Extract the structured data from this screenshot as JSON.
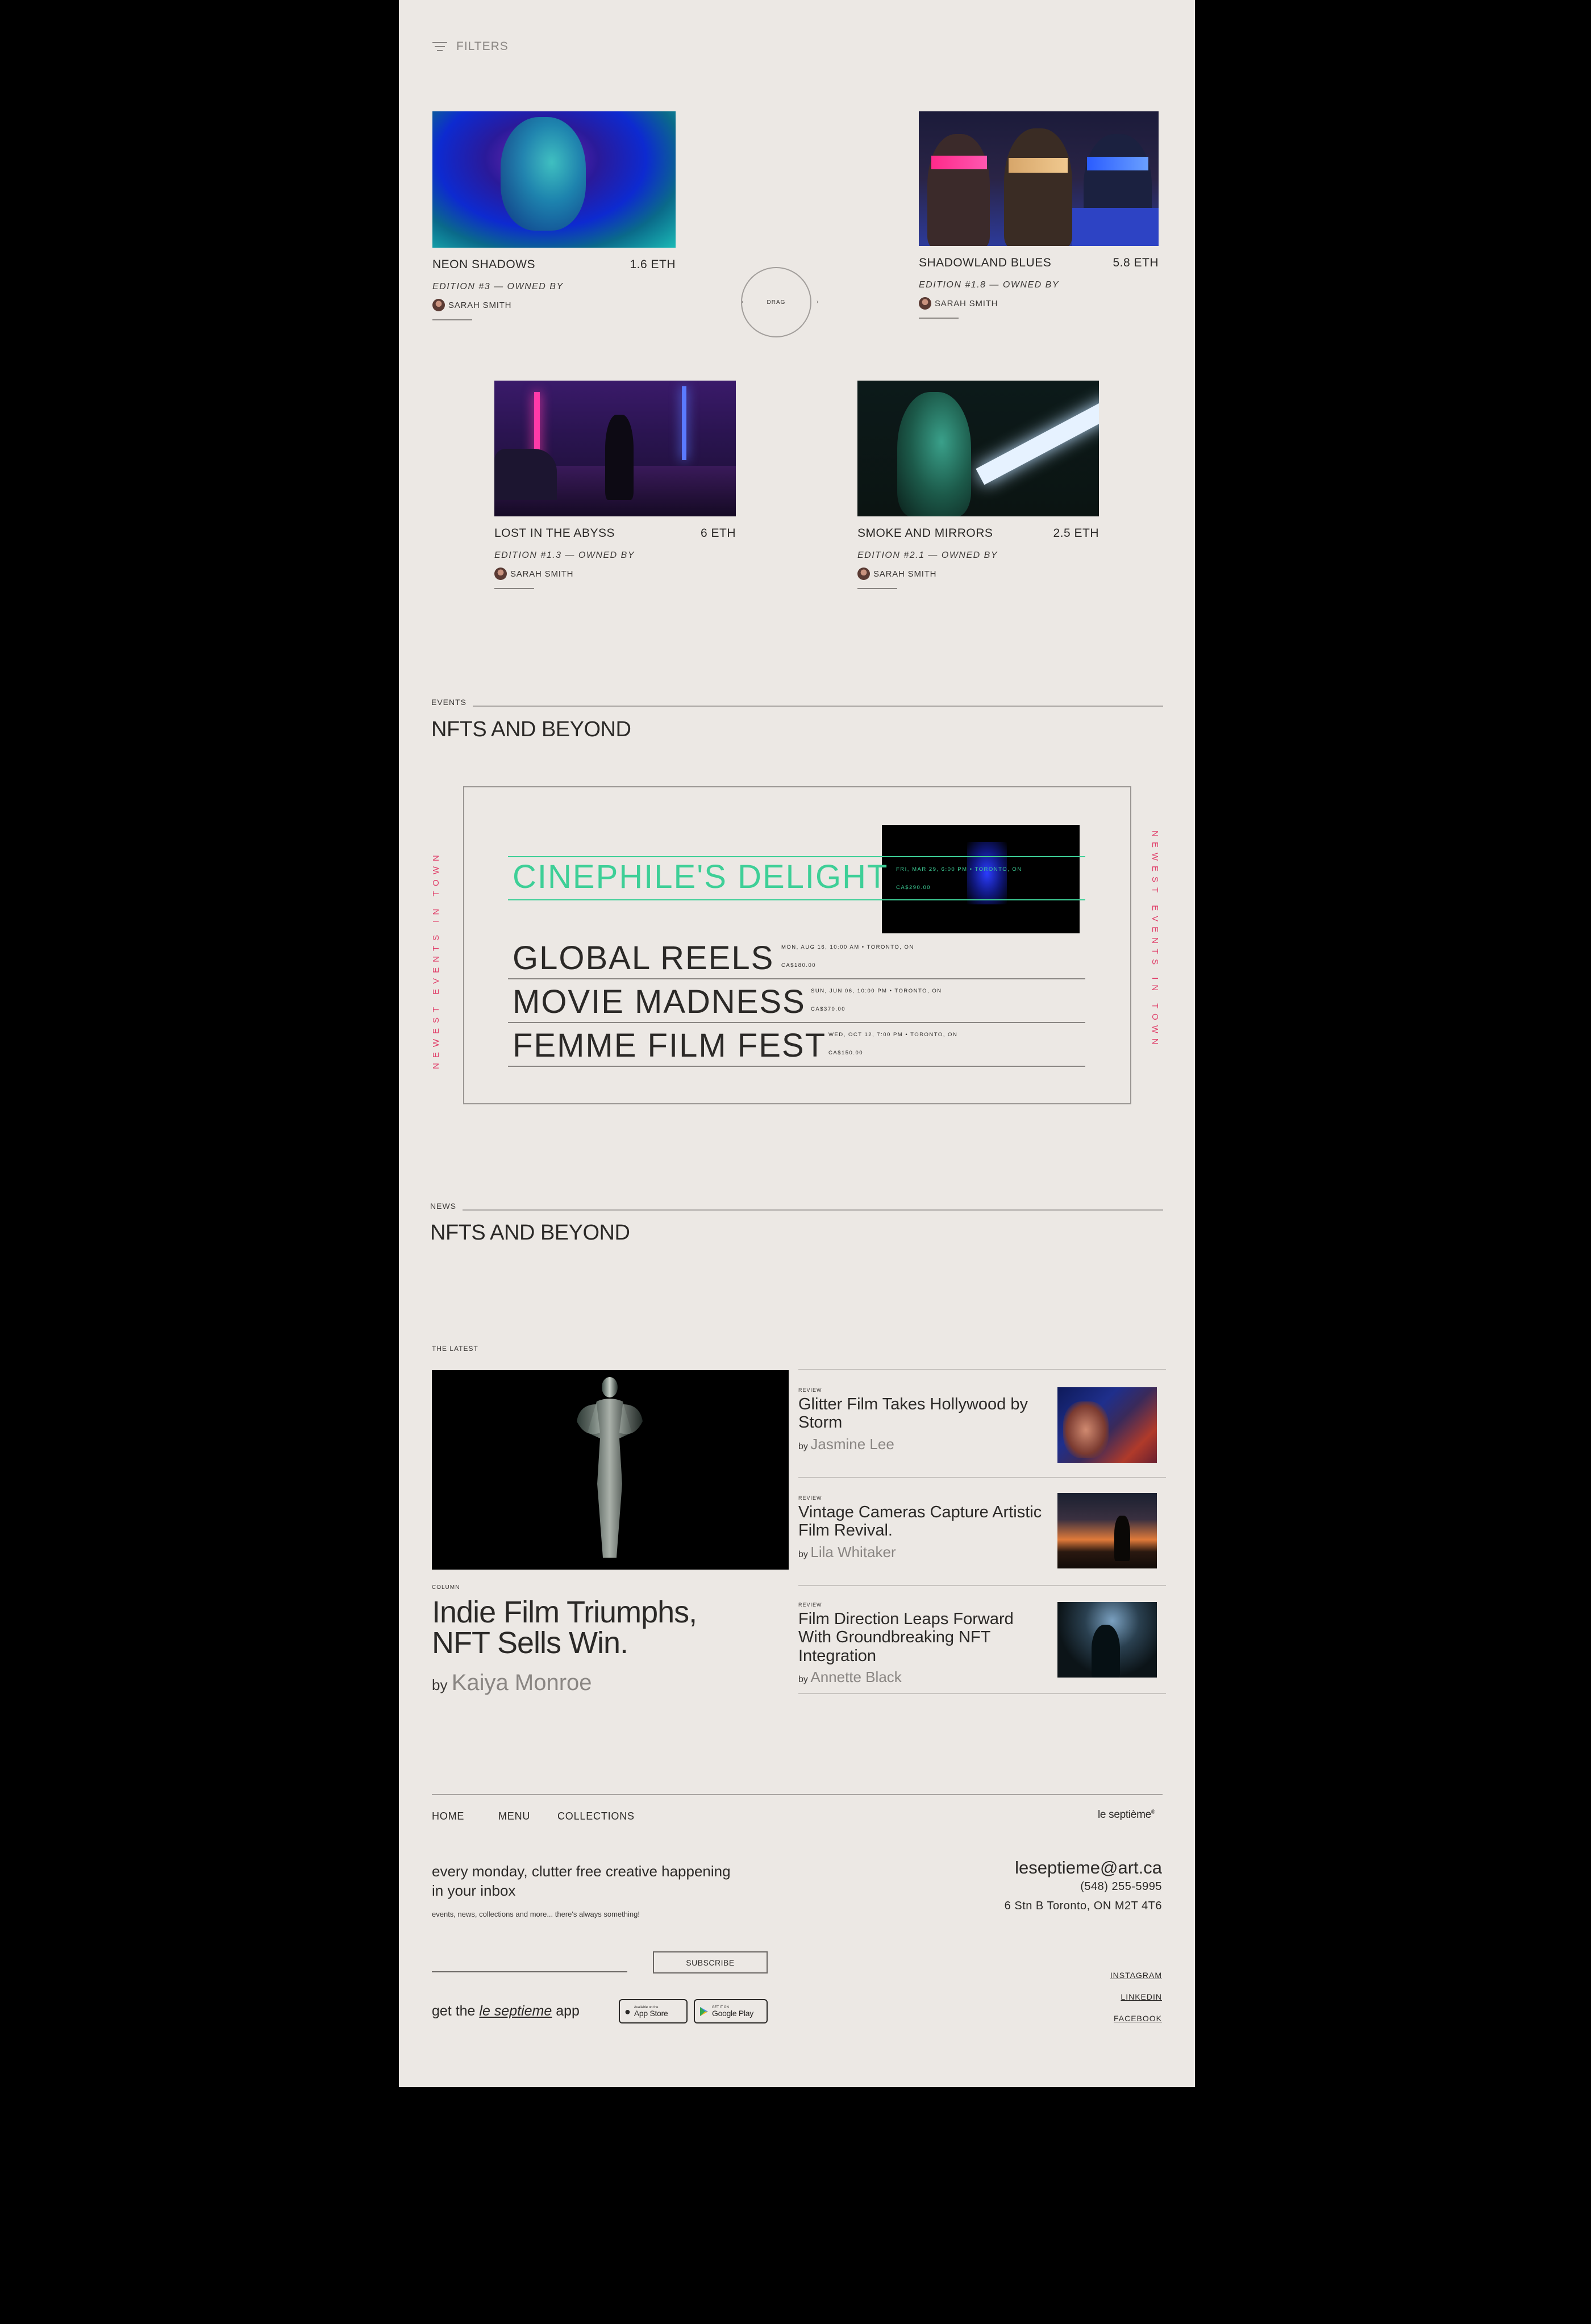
{
  "filters": {
    "label": "FILTERS"
  },
  "gallery": {
    "drag_label": "DRAG",
    "cards": [
      {
        "title": "NEON SHADOWS",
        "price": "1.6 ETH",
        "edition": "EDITION #3 — OWNED BY",
        "owner": "SARAH SMITH"
      },
      {
        "title": "SHADOWLAND BLUES",
        "price": "5.8 ETH",
        "edition": "EDITION #1.8 — OWNED BY",
        "owner": "SARAH SMITH"
      },
      {
        "title": "LOST IN THE ABYSS",
        "price": "6 ETH",
        "edition": "EDITION #1.3 — OWNED BY",
        "owner": "SARAH SMITH"
      },
      {
        "title": "SMOKE AND MIRRORS",
        "price": "2.5 ETH",
        "edition": "EDITION #2.1 — OWNED BY",
        "owner": "SARAH SMITH"
      }
    ]
  },
  "events": {
    "label": "EVENTS",
    "title": "NFTS AND BEYOND",
    "side_text": "NEWEST EVENTS IN TOWN",
    "items": [
      {
        "title": "CINEPHILE'S DELIGHT",
        "date": "FRI, MAR 29, 6:00 PM • TORONTO, ON",
        "price": "CA$290.00",
        "active": true
      },
      {
        "title": "GLOBAL REELS",
        "date": "MON, AUG 16, 10:00 AM • TORONTO, ON",
        "price": "CA$180.00"
      },
      {
        "title": "MOVIE MADNESS",
        "date": "SUN, JUN 06, 10:00 PM • TORONTO, ON",
        "price": "CA$370.00"
      },
      {
        "title": "FEMME FILM FEST",
        "date": "WED, OCT 12, 7:00 PM • TORONTO, ON",
        "price": "CA$150.00"
      }
    ],
    "accent_color": "#3ecf97"
  },
  "news": {
    "label": "NEWS",
    "title": "NFTS AND BEYOND",
    "latest_label": "THE LATEST",
    "feature": {
      "label": "COLUMN",
      "headline_1": "Indie Film Triumphs,",
      "headline_2": "NFT Sells Win.",
      "by": "by",
      "author": "Kaiya Monroe"
    },
    "items": [
      {
        "label": "REVIEW",
        "title": "Glitter Film Takes Hollywood by Storm",
        "by": "by",
        "author": "Jasmine Lee"
      },
      {
        "label": "REVIEW",
        "title": "Vintage Cameras Capture Artistic Film Revival.",
        "by": "by",
        "author": "Lila Whitaker"
      },
      {
        "label": "REVIEW",
        "title": "Film Direction Leaps Forward With Groundbreaking NFT Integration",
        "by": "by",
        "author": "Annette Black"
      }
    ]
  },
  "footer": {
    "nav": [
      "HOME",
      "MENU",
      "COLLECTIONS"
    ],
    "logo": "le septième",
    "logo_mark": "®",
    "newsletter_1": "every monday, clutter free creative happening",
    "newsletter_2": "in your inbox",
    "newsletter_sub": "events, news, collections and more... there's always something!",
    "subscribe": "SUBSCRIBE",
    "get_app_pre": "get the",
    "get_app_name": "le septieme",
    "get_app_post": "app",
    "app_store_small": "Available on the",
    "app_store": "App Store",
    "google_small": "GET IT ON",
    "google": "Google Play",
    "email": "leseptieme@art.ca",
    "phone": "(548) 255-5995",
    "address": "6 Stn B Toronto, ON M2T 4T6",
    "social": [
      "INSTAGRAM",
      "LINKEDIN",
      "FACEBOOK"
    ]
  }
}
